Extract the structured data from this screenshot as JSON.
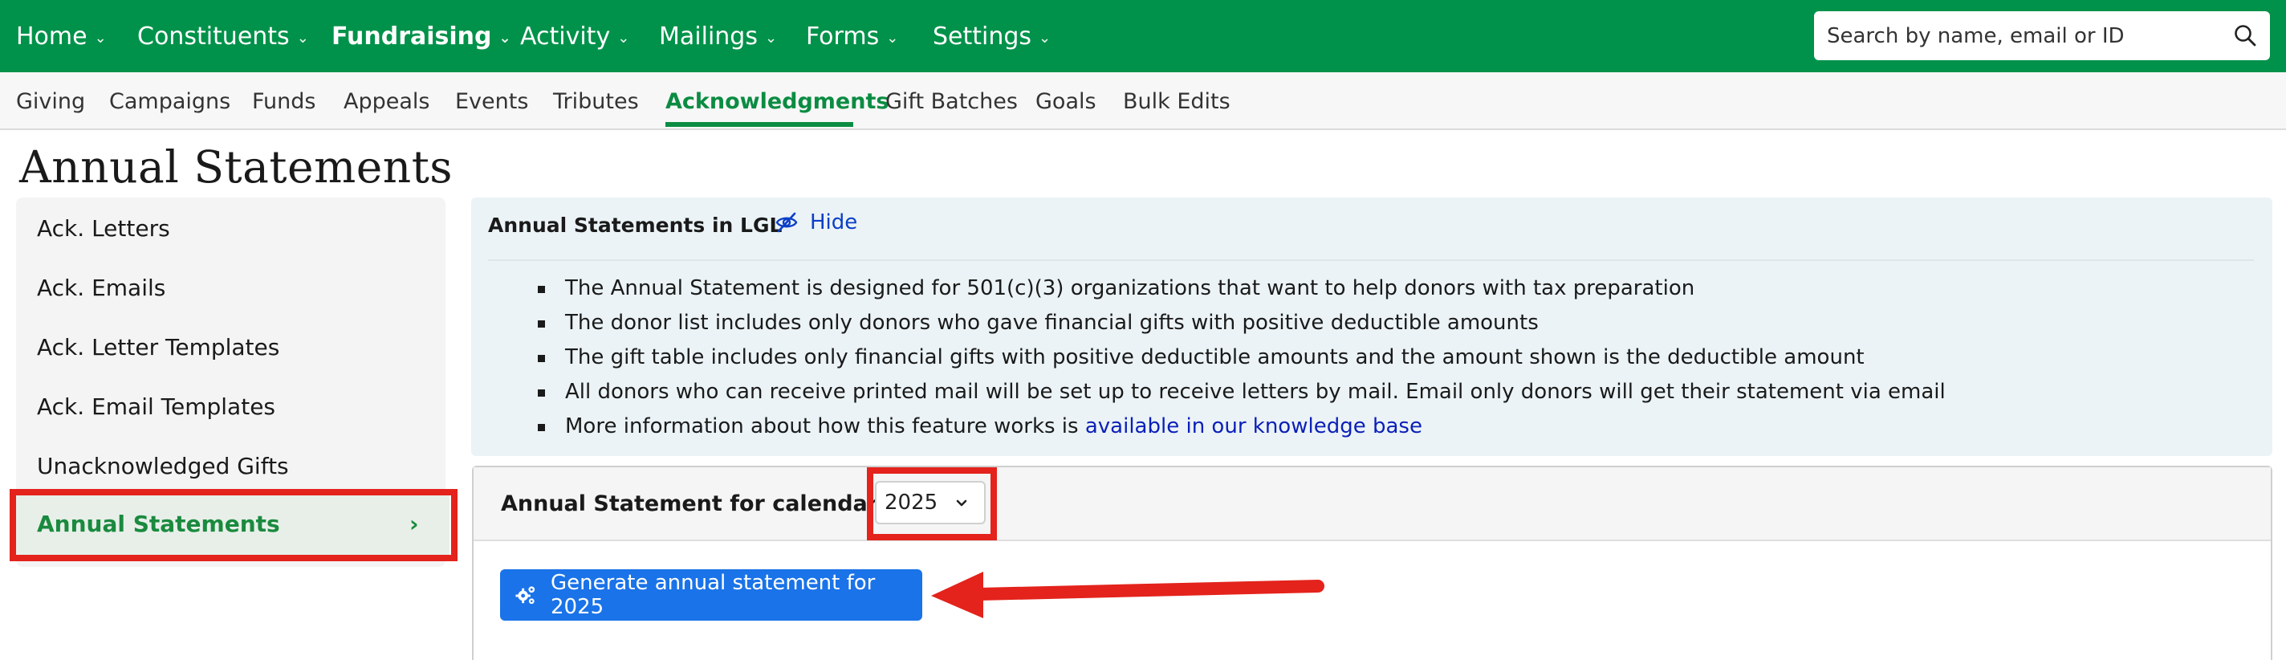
{
  "topnav": {
    "items": [
      {
        "label": "Home"
      },
      {
        "label": "Constituents"
      },
      {
        "label": "Fundraising"
      },
      {
        "label": "Activity"
      },
      {
        "label": "Mailings"
      },
      {
        "label": "Forms"
      },
      {
        "label": "Settings"
      }
    ],
    "active": "Fundraising",
    "search_placeholder": "Search by name, email or ID"
  },
  "subnav": {
    "items": [
      {
        "label": "Giving"
      },
      {
        "label": "Campaigns"
      },
      {
        "label": "Funds"
      },
      {
        "label": "Appeals"
      },
      {
        "label": "Events"
      },
      {
        "label": "Tributes"
      },
      {
        "label": "Acknowledgments"
      },
      {
        "label": "Gift Batches"
      },
      {
        "label": "Goals"
      },
      {
        "label": "Bulk Edits"
      }
    ],
    "active": "Acknowledgments"
  },
  "page": {
    "title": "Annual Statements"
  },
  "sidebar": {
    "items": [
      {
        "label": "Ack. Letters"
      },
      {
        "label": "Ack. Emails"
      },
      {
        "label": "Ack. Letter Templates"
      },
      {
        "label": "Ack. Email Templates"
      },
      {
        "label": "Unacknowledged Gifts"
      },
      {
        "label": "Annual Statements"
      }
    ],
    "active": "Annual Statements",
    "active_chevron": "›"
  },
  "info": {
    "title": "Annual Statements in LGL",
    "hide_label": "Hide",
    "bullets": [
      "The Annual Statement is designed for 501(c)(3) organizations that want to help donors with tax preparation",
      "The donor list includes only donors who gave financial gifts with positive deductible amounts",
      "The gift table includes only financial gifts with positive deductible amounts and the amount shown is the deductible amount",
      "All donors who can receive printed mail will be set up to receive letters by mail. Email only donors will get their statement via email"
    ],
    "last_bullet_prefix": "More information about how this feature works is ",
    "last_bullet_link": "available in our knowledge base"
  },
  "statement": {
    "year_label": "Annual Statement for calendar year:",
    "year_value": "2025",
    "generate_label": "Generate annual statement for 2025"
  },
  "colors": {
    "brand_green": "#00924a",
    "active_green": "#0b8c42",
    "button_blue": "#1a73e8",
    "annotation_red": "#e3231c"
  }
}
